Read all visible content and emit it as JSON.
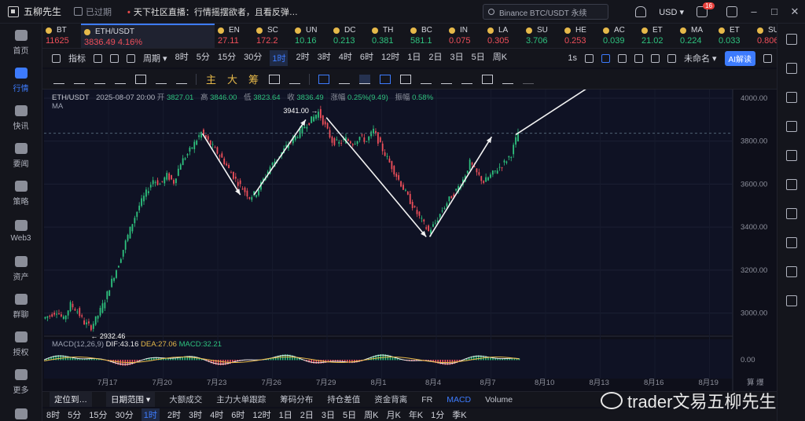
{
  "app": {
    "name": "五柳先生",
    "expired": "已过期",
    "live_prefix": "•",
    "live_text": "天下社区直播：行情摇摆欲者，且看反弹…"
  },
  "search": {
    "placeholder": "Binance BTC/USDT 永续"
  },
  "header": {
    "currency": "USD",
    "inbox_badge": "16"
  },
  "nav": [
    {
      "label": "首页",
      "icon": "home-icon"
    },
    {
      "label": "行情",
      "icon": "bar-chart-icon",
      "active": true
    },
    {
      "label": "快讯",
      "icon": "news-icon"
    },
    {
      "label": "要闻",
      "icon": "document-icon"
    },
    {
      "label": "策略",
      "icon": "robot-icon"
    },
    {
      "label": "Web3",
      "icon": "web3-icon"
    },
    {
      "label": "资产",
      "icon": "wallet-icon"
    },
    {
      "label": "群聊",
      "icon": "chat-icon"
    },
    {
      "label": "授权",
      "icon": "key-icon"
    },
    {
      "label": "更多",
      "icon": "more-icon"
    },
    {
      "label": "VIP",
      "icon": "vip-icon"
    }
  ],
  "tickers": [
    {
      "sym": "BT",
      "price": "11625",
      "dir": "dn"
    },
    {
      "sym": "ETH/USDT",
      "price": "3836.49",
      "change": "4.16%",
      "dir": "dn",
      "active": true
    },
    {
      "sym": "EN",
      "price": "27.11",
      "dir": "dn"
    },
    {
      "sym": "SC",
      "price": "172.2",
      "dir": "dn"
    },
    {
      "sym": "UN",
      "price": "10.16",
      "dir": "up"
    },
    {
      "sym": "DC",
      "price": "0.213",
      "dir": "up"
    },
    {
      "sym": "TH",
      "price": "0.381",
      "dir": "up"
    },
    {
      "sym": "BC",
      "price": "581.1",
      "dir": "up"
    },
    {
      "sym": "IN",
      "price": "0.075",
      "dir": "dn"
    },
    {
      "sym": "LA",
      "price": "0.305",
      "dir": "dn"
    },
    {
      "sym": "SU",
      "price": "3.706",
      "dir": "up"
    },
    {
      "sym": "HE",
      "price": "0.253",
      "dir": "dn"
    },
    {
      "sym": "AC",
      "price": "0.039",
      "dir": "up"
    },
    {
      "sym": "ET",
      "price": "21.02",
      "dir": "up"
    },
    {
      "sym": "MA",
      "price": "0.224",
      "dir": "up"
    },
    {
      "sym": "ET",
      "price": "0.033",
      "dir": "up"
    },
    {
      "sym": "SU",
      "price": "0.806",
      "dir": "dn"
    },
    {
      "sym": "AD",
      "price": "0.769",
      "dir": "dn"
    },
    {
      "sym": "BA",
      "price": "0.0",
      "dir": "up"
    }
  ],
  "toolbar": {
    "indicators": "指标",
    "period": "周期",
    "timeframes": [
      "8时",
      "5分",
      "15分",
      "30分",
      "1时",
      "2时",
      "3时",
      "4时",
      "6时",
      "12时",
      "1日",
      "2日",
      "3日",
      "5日",
      "周K"
    ],
    "selected_tf": "1时",
    "seconds": "1s",
    "layout_name": "未命名",
    "ai_label": "AI解读"
  },
  "drawbar": {
    "main": "主",
    "big": "大",
    "chip": "筹"
  },
  "chart_info": {
    "pair": "ETH/USDT",
    "date": "2025-08-07 20:00",
    "open_label": "开",
    "open": "3827.01",
    "high_label": "高",
    "high": "3846.00",
    "low_label": "低",
    "low": "3823.64",
    "close_label": "收",
    "close": "3836.49",
    "chg_label": "涨幅",
    "chg": "0.25%(9.49)",
    "amp_label": "振幅",
    "amp": "0.58%",
    "ma_label": "MA"
  },
  "macd_info": {
    "label": "MACD(12,26,9)",
    "dif": "DIF:43.16",
    "dea": "DEA:27.06",
    "macd": "MACD:32.21"
  },
  "annotations": {
    "high": "3941.00",
    "low": "2932.46"
  },
  "chart_data": {
    "type": "line",
    "pair": "ETH/USDT",
    "x_ticks": [
      "7月17",
      "7月20",
      "7月23",
      "7月26",
      "7月29",
      "8月1",
      "8月4",
      "8月7",
      "8月10",
      "8月13",
      "8月16",
      "8月19"
    ],
    "y_ticks": [
      3000,
      3200,
      3400,
      3600,
      3800,
      4000
    ],
    "ylim": [
      2900,
      4040
    ],
    "price_path": [
      [
        0,
        2975
      ],
      [
        2,
        2990
      ],
      [
        4,
        3010
      ],
      [
        6,
        2970
      ],
      [
        8,
        3040
      ],
      [
        10,
        3010
      ],
      [
        12,
        2955
      ],
      [
        14,
        2935
      ],
      [
        16,
        2990
      ],
      [
        18,
        3060
      ],
      [
        20,
        3150
      ],
      [
        22,
        3230
      ],
      [
        24,
        3330
      ],
      [
        26,
        3420
      ],
      [
        28,
        3500
      ],
      [
        30,
        3560
      ],
      [
        32,
        3620
      ],
      [
        34,
        3600
      ],
      [
        36,
        3640
      ],
      [
        38,
        3610
      ],
      [
        40,
        3700
      ],
      [
        42,
        3740
      ],
      [
        44,
        3790
      ],
      [
        46,
        3840
      ],
      [
        48,
        3800
      ],
      [
        50,
        3760
      ],
      [
        52,
        3720
      ],
      [
        54,
        3670
      ],
      [
        56,
        3620
      ],
      [
        58,
        3580
      ],
      [
        60,
        3540
      ],
      [
        62,
        3560
      ],
      [
        64,
        3620
      ],
      [
        66,
        3680
      ],
      [
        68,
        3720
      ],
      [
        70,
        3760
      ],
      [
        72,
        3800
      ],
      [
        74,
        3830
      ],
      [
        76,
        3870
      ],
      [
        78,
        3900
      ],
      [
        80,
        3935
      ],
      [
        82,
        3870
      ],
      [
        84,
        3800
      ],
      [
        86,
        3790
      ],
      [
        88,
        3810
      ],
      [
        90,
        3790
      ],
      [
        92,
        3820
      ],
      [
        94,
        3800
      ],
      [
        96,
        3850
      ],
      [
        98,
        3780
      ],
      [
        100,
        3720
      ],
      [
        102,
        3660
      ],
      [
        104,
        3600
      ],
      [
        106,
        3540
      ],
      [
        108,
        3480
      ],
      [
        110,
        3430
      ],
      [
        112,
        3380
      ],
      [
        114,
        3420
      ],
      [
        116,
        3480
      ],
      [
        118,
        3530
      ],
      [
        120,
        3570
      ],
      [
        122,
        3620
      ],
      [
        124,
        3700
      ],
      [
        126,
        3650
      ],
      [
        128,
        3610
      ],
      [
        130,
        3640
      ],
      [
        132,
        3670
      ],
      [
        134,
        3700
      ],
      [
        136,
        3740
      ],
      [
        138,
        3840
      ]
    ],
    "x_max": 200,
    "last_price": 3836.49
  }
}
